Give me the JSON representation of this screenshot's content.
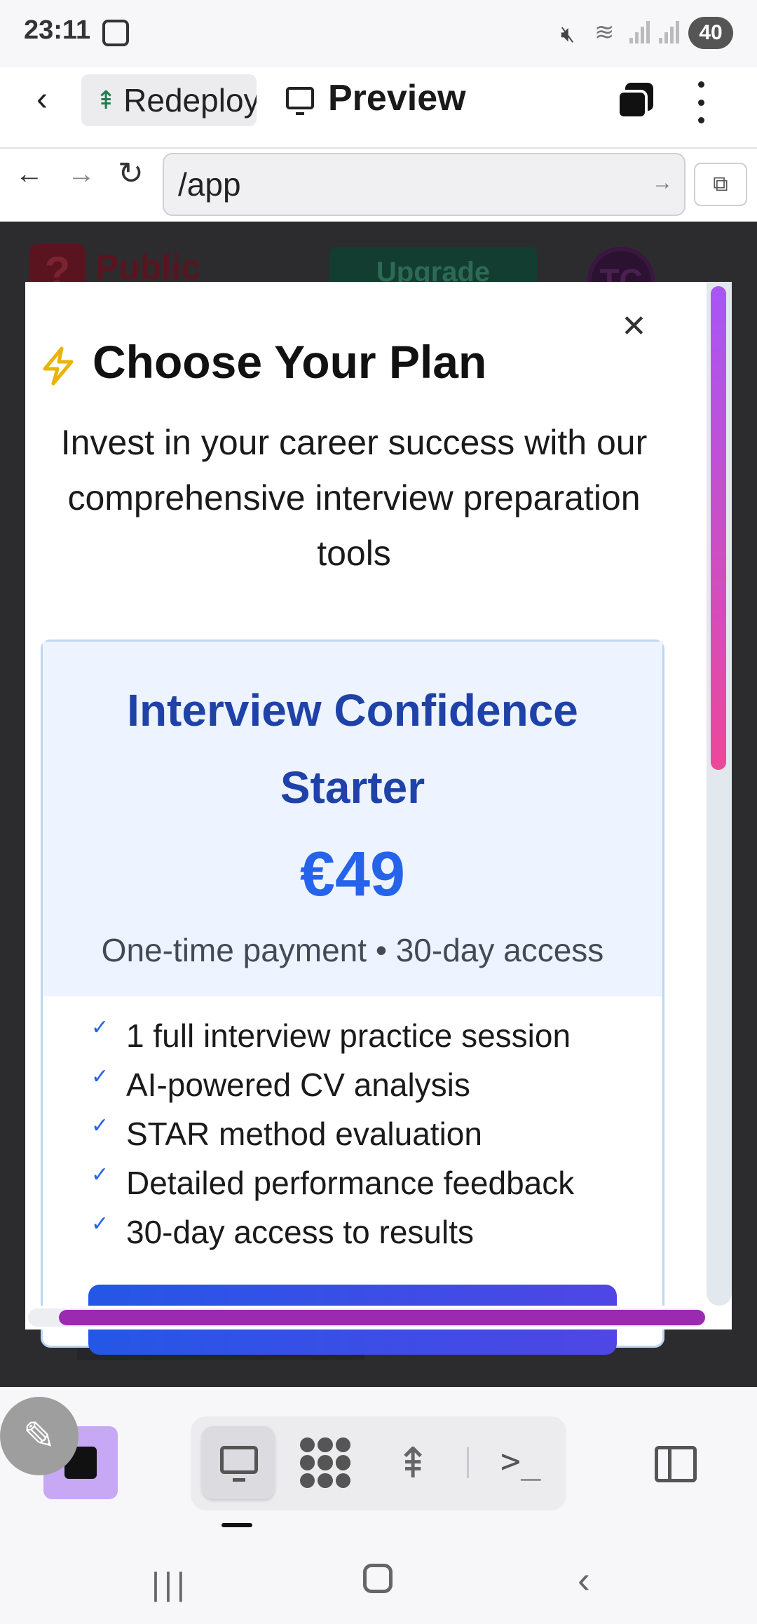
{
  "status_bar": {
    "time": "23:11",
    "battery": "40",
    "icons": [
      "screenshot-icon",
      "mute-icon",
      "wifi-icon",
      "signal-icon",
      "signal-icon"
    ]
  },
  "header": {
    "project_label": "Redeploy",
    "title": "Preview"
  },
  "browser": {
    "url": "/app"
  },
  "background_app": {
    "logo_text": "?",
    "public_label": "Public",
    "upgrade_label": "Upgrade",
    "avatar_initials": "TC"
  },
  "modal": {
    "title": "Choose Your Plan",
    "subtitle": "Invest in your career success with our comprehensive interview preparation tools",
    "plan": {
      "name": "Interview Confidence Starter",
      "price": "€49",
      "terms": "One-time payment • 30-day access",
      "features": [
        "1 full interview practice session",
        "AI-powered CV analysis",
        "STAR method evaluation",
        "Detailed performance feedback",
        "30-day access to results"
      ]
    }
  },
  "colors": {
    "accent": "#2563eb",
    "plan_name": "#1f42a8",
    "scrollbar_gradient": [
      "#a855f7",
      "#ec4899"
    ],
    "stop_button": "#c6a8f5"
  }
}
